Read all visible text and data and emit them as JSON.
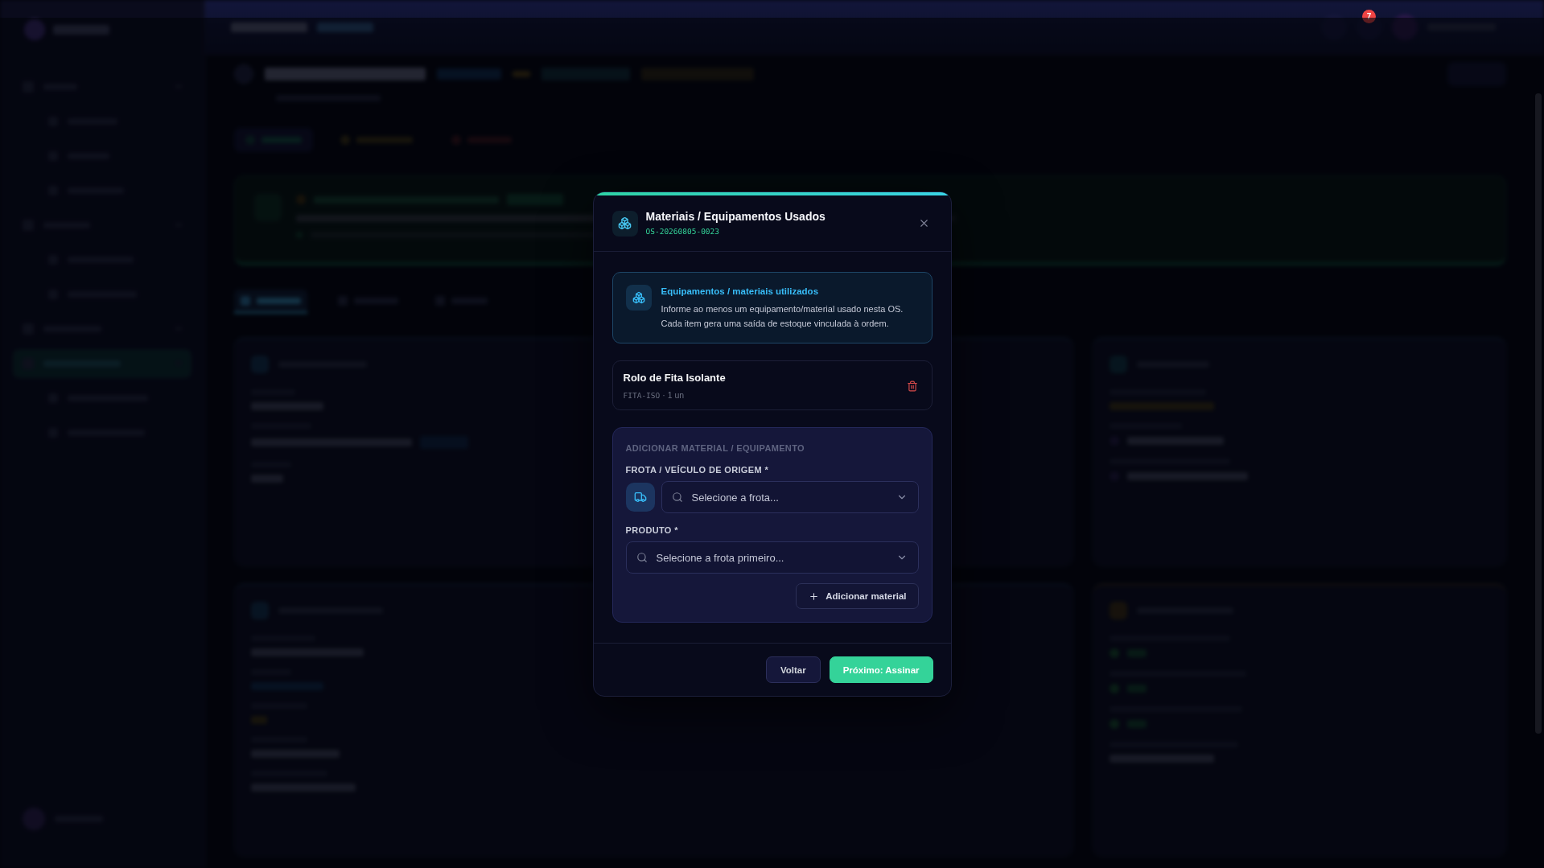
{
  "header": {
    "notification_count": "7"
  },
  "page_tabs": [
    {
      "selected": true
    },
    {
      "selected": false
    },
    {
      "selected": false
    }
  ],
  "modal": {
    "title": "Materiais / Equipamentos Usados",
    "order_code": "OS-20260805-0023",
    "info": {
      "title": "Equipamentos / materiais utilizados",
      "lines": [
        "Informe ao menos um equipamento/material usado nesta OS.",
        "Cada item gera uma saída de estoque vinculada à ordem."
      ]
    },
    "items": [
      {
        "name": "Rolo de Fita Isolante",
        "code": "FITA-ISO",
        "detail": "· 1 un"
      }
    ],
    "add_section": {
      "title": "ADICIONAR MATERIAL / EQUIPAMENTO",
      "fields": [
        {
          "kind": "fleet",
          "label": "FROTA / VEÍCULO DE ORIGEM *",
          "placeholder": "Selecione a frota..."
        },
        {
          "kind": "product",
          "label": "PRODUTO *",
          "placeholder": "Selecione a frota primeiro..."
        }
      ],
      "add_button": "Adicionar material"
    },
    "buttons": [
      {
        "kind": "secondary",
        "label": "Voltar"
      },
      {
        "kind": "primary",
        "label": "Próximo: Assinar"
      }
    ]
  }
}
